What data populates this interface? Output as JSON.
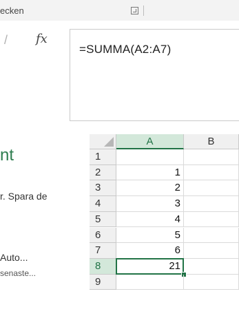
{
  "ribbon": {
    "group_label": "ecken",
    "launcher_icon": "dialog-launcher-icon"
  },
  "formula_bar": {
    "fx_label": "fx",
    "formula": "=SUMMA(A2:A7)"
  },
  "left_panel": {
    "title": "nt",
    "line1": "r. Spara de",
    "line2": "Auto...",
    "line3": "senaste..."
  },
  "grid": {
    "columns": [
      "A",
      "B"
    ],
    "selected_column": "A",
    "selected_row": "8",
    "rows": [
      {
        "num": "1",
        "a": ""
      },
      {
        "num": "2",
        "a": "1"
      },
      {
        "num": "3",
        "a": "2"
      },
      {
        "num": "4",
        "a": "3"
      },
      {
        "num": "5",
        "a": "4"
      },
      {
        "num": "6",
        "a": "5"
      },
      {
        "num": "7",
        "a": "6"
      },
      {
        "num": "8",
        "a": "21"
      },
      {
        "num": "9",
        "a": ""
      }
    ]
  },
  "colors": {
    "accent": "#217346",
    "header_selected": "#d3e8da",
    "title_green": "#2e7d4f"
  }
}
